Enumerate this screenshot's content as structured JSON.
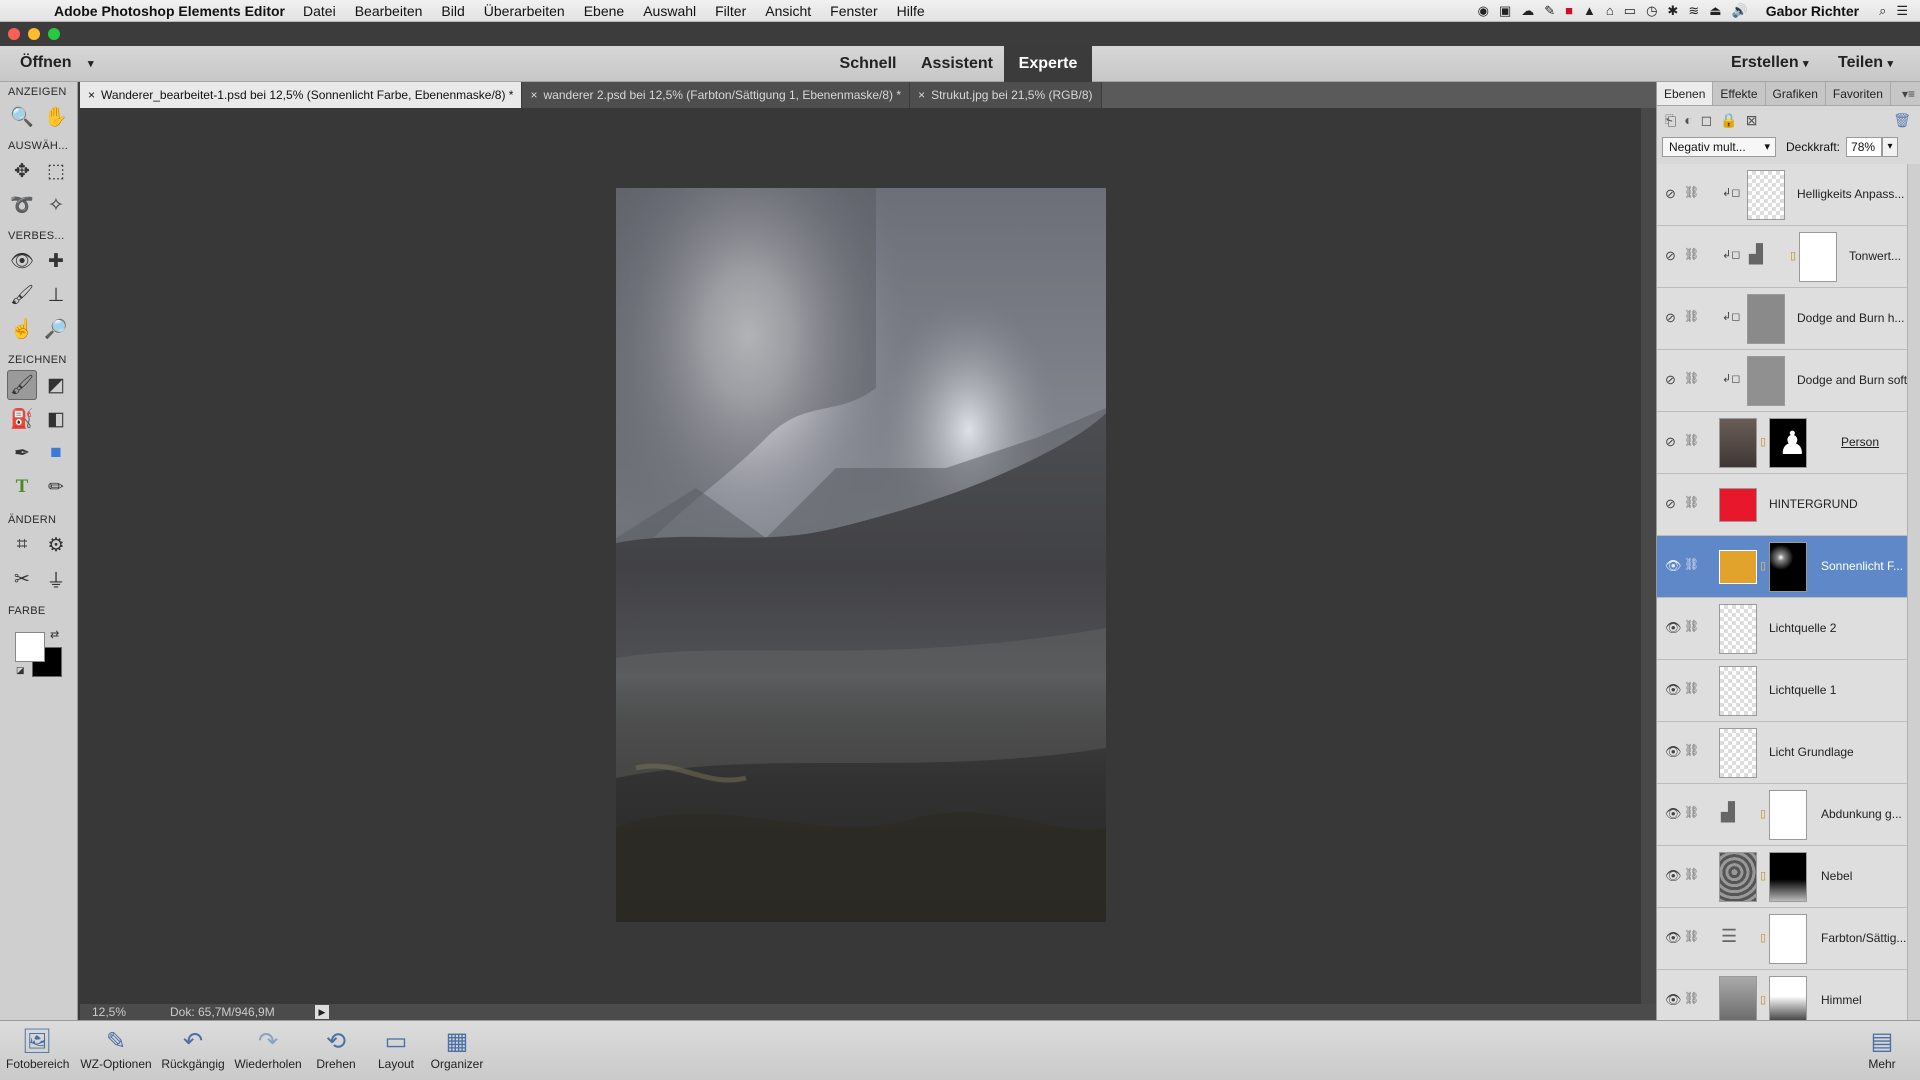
{
  "menubar": {
    "app_name": "Adobe Photoshop Elements Editor",
    "items": [
      "Datei",
      "Bearbeiten",
      "Bild",
      "Überarbeiten",
      "Ebene",
      "Auswahl",
      "Filter",
      "Ansicht",
      "Fenster",
      "Hilfe"
    ],
    "user": "Gabor Richter"
  },
  "modebar": {
    "open_label": "Öffnen",
    "tabs": [
      "Schnell",
      "Assistent",
      "Experte"
    ],
    "active_tab": "Experte",
    "create_label": "Erstellen",
    "share_label": "Teilen"
  },
  "tools": {
    "sections": [
      "ANZEIGEN",
      "AUSWÄH...",
      "VERBES...",
      "ZEICHNEN",
      "ÄNDERN",
      "FARBE"
    ]
  },
  "doc_tabs": [
    "Wanderer_bearbeitet-1.psd bei 12,5% (Sonnenlicht Farbe, Ebenenmaske/8) *",
    "wanderer 2.psd bei 12,5% (Farbton/Sättigung 1, Ebenenmaske/8) *",
    "Strukut.jpg bei 21,5% (RGB/8)"
  ],
  "status": {
    "zoom": "12,5%",
    "doc_size": "Dok: 65,7M/946,9M"
  },
  "panel": {
    "tabs": [
      "Ebenen",
      "Effekte",
      "Grafiken",
      "Favoriten"
    ],
    "blend_mode": "Negativ mult...",
    "opacity_label": "Deckkraft:",
    "opacity_value": "78%"
  },
  "layers": [
    {
      "name": "Helligkeits Anpass...",
      "visible": false
    },
    {
      "name": "Tonwert...",
      "visible": false
    },
    {
      "name": "Dodge and Burn h...",
      "visible": false
    },
    {
      "name": "Dodge and Burn soft",
      "visible": false
    },
    {
      "name": "Person",
      "visible": false
    },
    {
      "name": "HINTERGRUND",
      "visible": false
    },
    {
      "name": "Sonnenlicht F...",
      "visible": true,
      "selected": true
    },
    {
      "name": "Lichtquelle 2",
      "visible": true
    },
    {
      "name": "Lichtquelle 1",
      "visible": true
    },
    {
      "name": "Licht Grundlage",
      "visible": true
    },
    {
      "name": "Abdunkung g...",
      "visible": true
    },
    {
      "name": "Nebel",
      "visible": true
    },
    {
      "name": "Farbton/Sättig...",
      "visible": true
    },
    {
      "name": "Himmel",
      "visible": true
    }
  ],
  "bottombar": {
    "buttons": [
      "Fotobereich",
      "WZ-Optionen",
      "Rückgängig",
      "Wiederholen",
      "Drehen",
      "Layout",
      "Organizer"
    ],
    "more_label": "Mehr"
  },
  "colors": {
    "accent_selected_layer": "#5e88c8",
    "hintergrund_fill": "#e8172c",
    "sonnenlicht_fill": "#e2a32c"
  }
}
